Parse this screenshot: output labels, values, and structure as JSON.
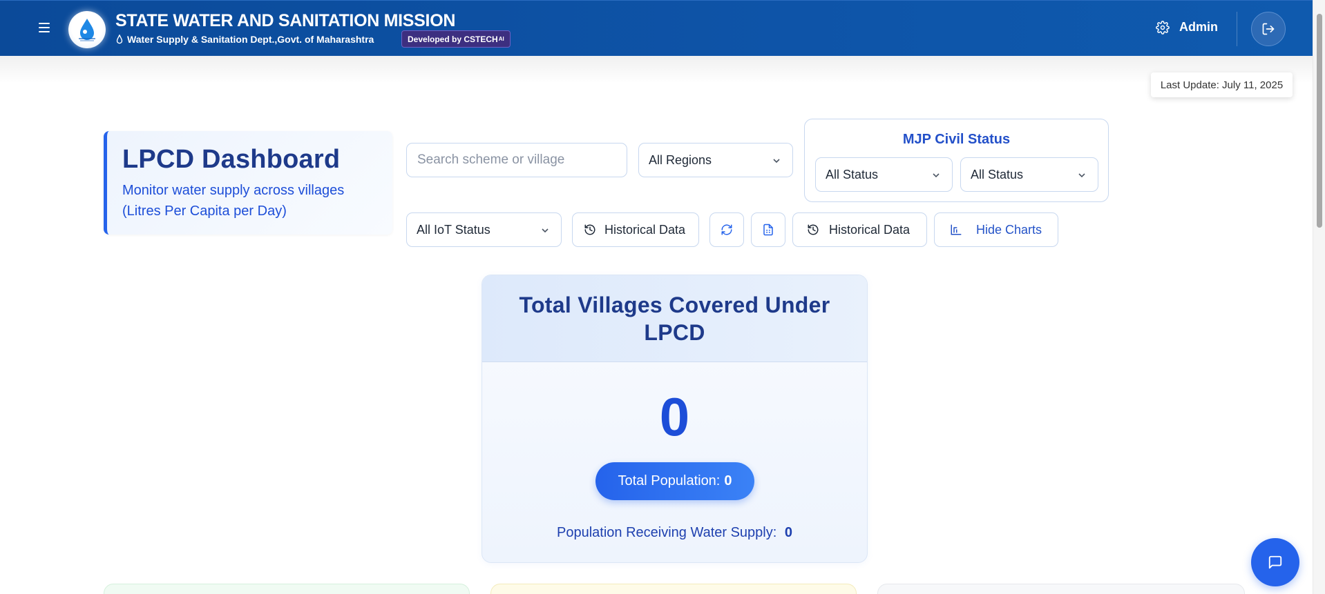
{
  "header": {
    "title": "STATE WATER AND SANITATION MISSION",
    "subtitle": "Water Supply & Sanitation Dept.,Govt. of Maharashtra",
    "badge": "Developed by CSTECH",
    "badge_sup": "AI",
    "user": "Admin",
    "icons": [
      "hamburger-icon",
      "logo",
      "water-drop-icon",
      "gear-icon",
      "logout-icon"
    ]
  },
  "last_update": "Last Update: July 11, 2025",
  "title_card": {
    "title": "LPCD Dashboard",
    "subtitle": "Monitor water supply across villages (Litres Per Capita per Day)"
  },
  "filters": {
    "search_placeholder": "Search scheme or village",
    "region": "All Regions",
    "mjp_title": "MJP Civil Status",
    "mjp_status_1": "All Status",
    "mjp_status_2": "All Status",
    "iot_status": "All IoT Status",
    "historical_1": "Historical Data",
    "historical_2": "Historical Data",
    "hide_charts": "Hide Charts"
  },
  "stats": {
    "title": "Total Villages Covered Under LPCD",
    "value": "0",
    "population_label": "Total Population:",
    "population_value": "0",
    "supply_label": "Population Receiving Water Supply:",
    "supply_value": "0"
  },
  "colors": {
    "header": "#0e54a8",
    "accent": "#2563eb",
    "title": "#1e3a8a"
  }
}
